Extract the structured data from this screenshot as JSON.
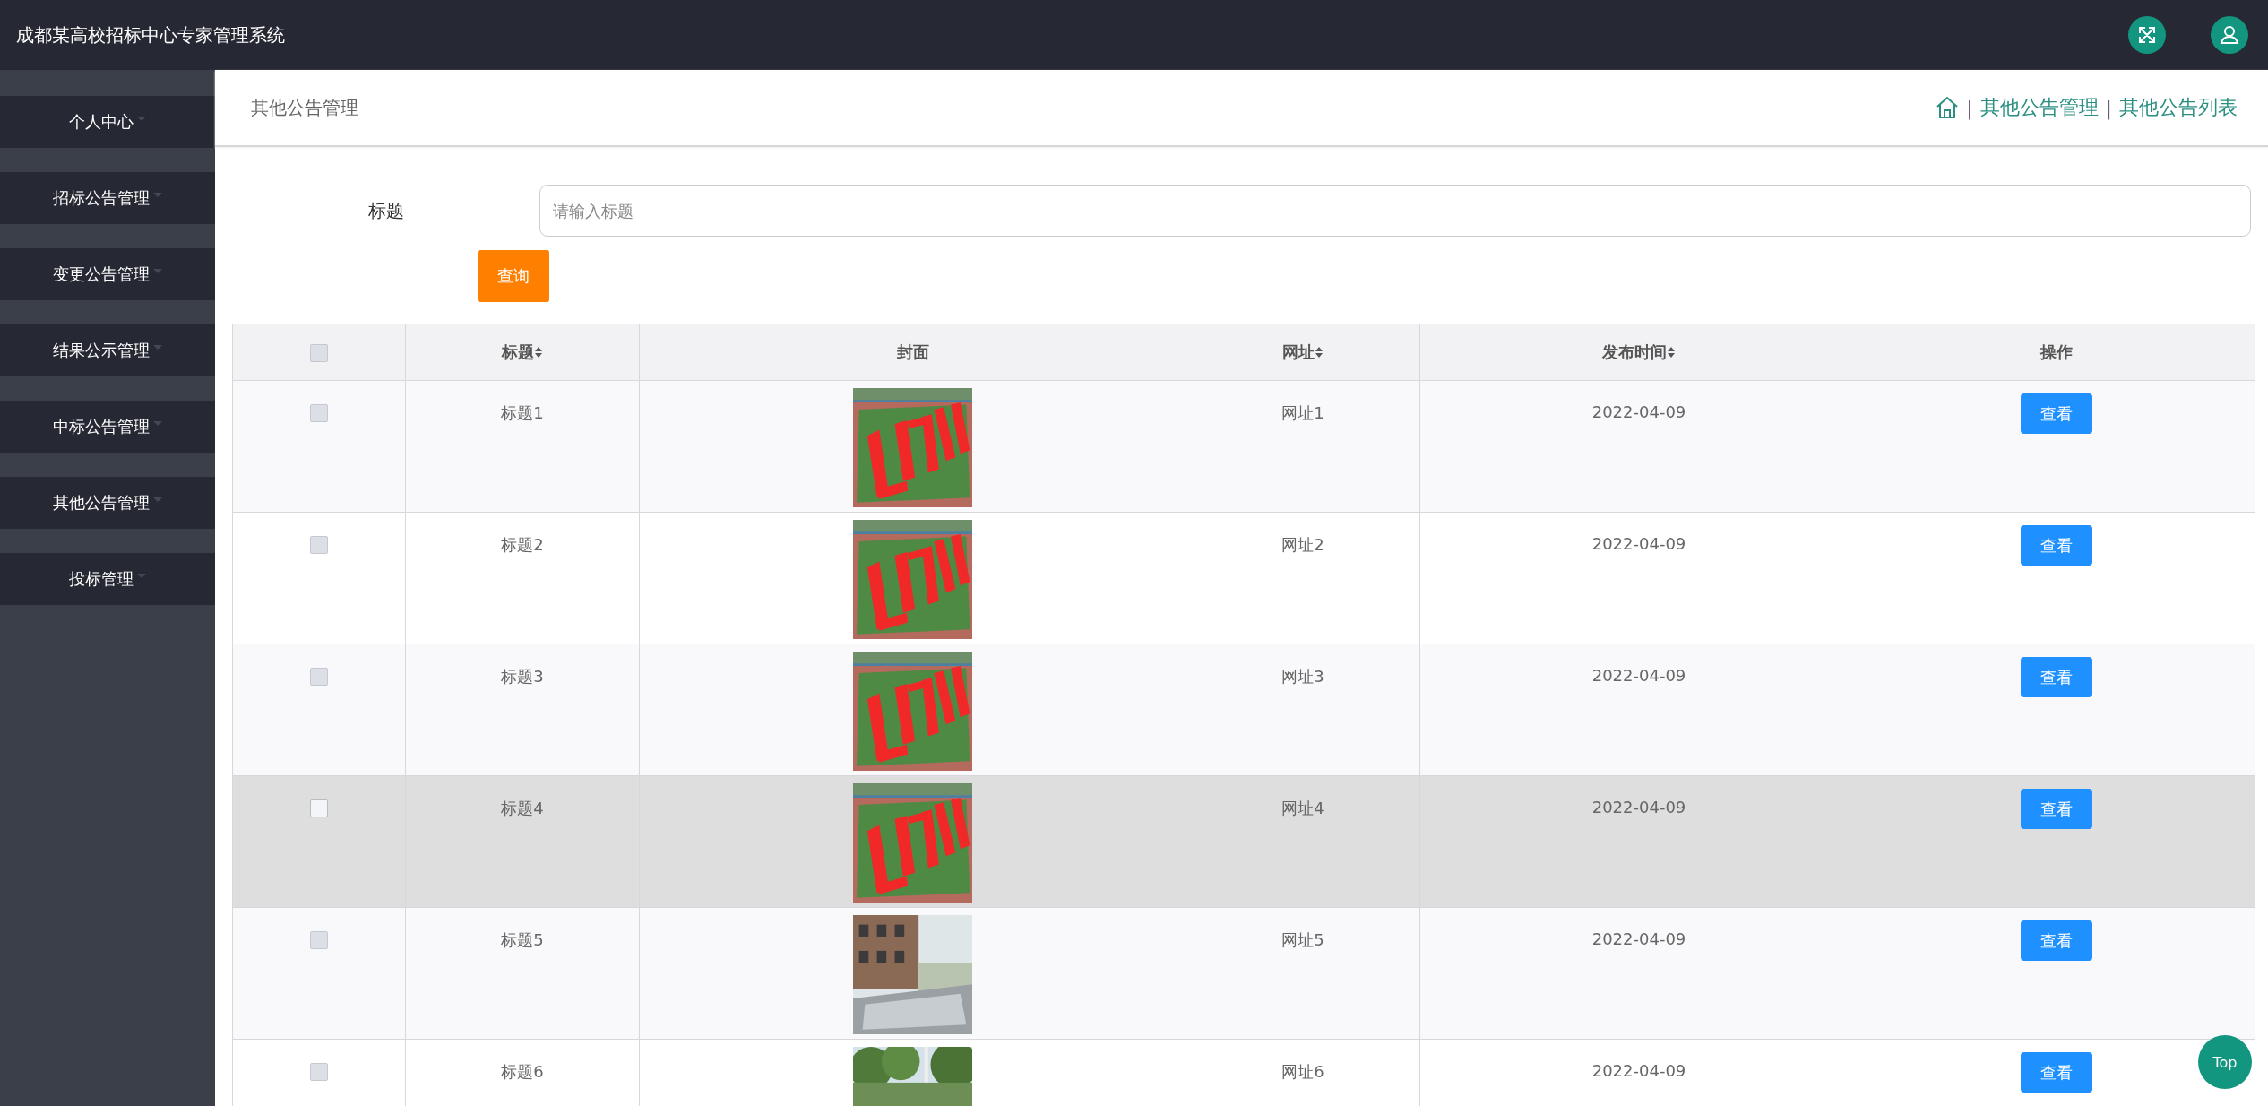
{
  "header": {
    "title": "成都某高校招标中心专家管理系统"
  },
  "sidebar": {
    "items": [
      {
        "label": "个人中心"
      },
      {
        "label": "招标公告管理"
      },
      {
        "label": "变更公告管理"
      },
      {
        "label": "结果公示管理"
      },
      {
        "label": "中标公告管理"
      },
      {
        "label": "其他公告管理"
      },
      {
        "label": "投标管理"
      }
    ]
  },
  "page": {
    "title": "其他公告管理",
    "breadcrumb_separator": "|",
    "breadcrumb": [
      "其他公告管理",
      "其他公告列表"
    ]
  },
  "search": {
    "label": "标题",
    "placeholder": "请输入标题",
    "button": "查询"
  },
  "table": {
    "columns": [
      {
        "kind": "checkbox",
        "checked": false
      },
      {
        "kind": "text",
        "label": "标题",
        "sortable": true
      },
      {
        "kind": "text",
        "label": "封面",
        "sortable": false
      },
      {
        "kind": "text",
        "label": "网址",
        "sortable": true
      },
      {
        "kind": "text",
        "label": "发布时间",
        "sortable": true
      },
      {
        "kind": "text",
        "label": "操作",
        "sortable": false
      }
    ],
    "rows": [
      {
        "checked": false,
        "hovered": false,
        "title": "标题1",
        "url": "网址1",
        "date": "2022-04-09",
        "action": "查看"
      },
      {
        "checked": false,
        "hovered": false,
        "title": "标题2",
        "url": "网址2",
        "date": "2022-04-09",
        "action": "查看"
      },
      {
        "checked": false,
        "hovered": false,
        "title": "标题3",
        "url": "网址3",
        "date": "2022-04-09",
        "action": "查看"
      },
      {
        "checked": false,
        "hovered": true,
        "title": "标题4",
        "url": "网址4",
        "date": "2022-04-09",
        "action": "查看"
      },
      {
        "checked": false,
        "hovered": false,
        "title": "标题5",
        "url": "网址5",
        "date": "2022-04-09",
        "action": "查看"
      },
      {
        "checked": false,
        "hovered": false,
        "title": "标题6",
        "url": "网址6",
        "date": "2022-04-09",
        "action": "查看"
      }
    ]
  },
  "top_button": "Top"
}
